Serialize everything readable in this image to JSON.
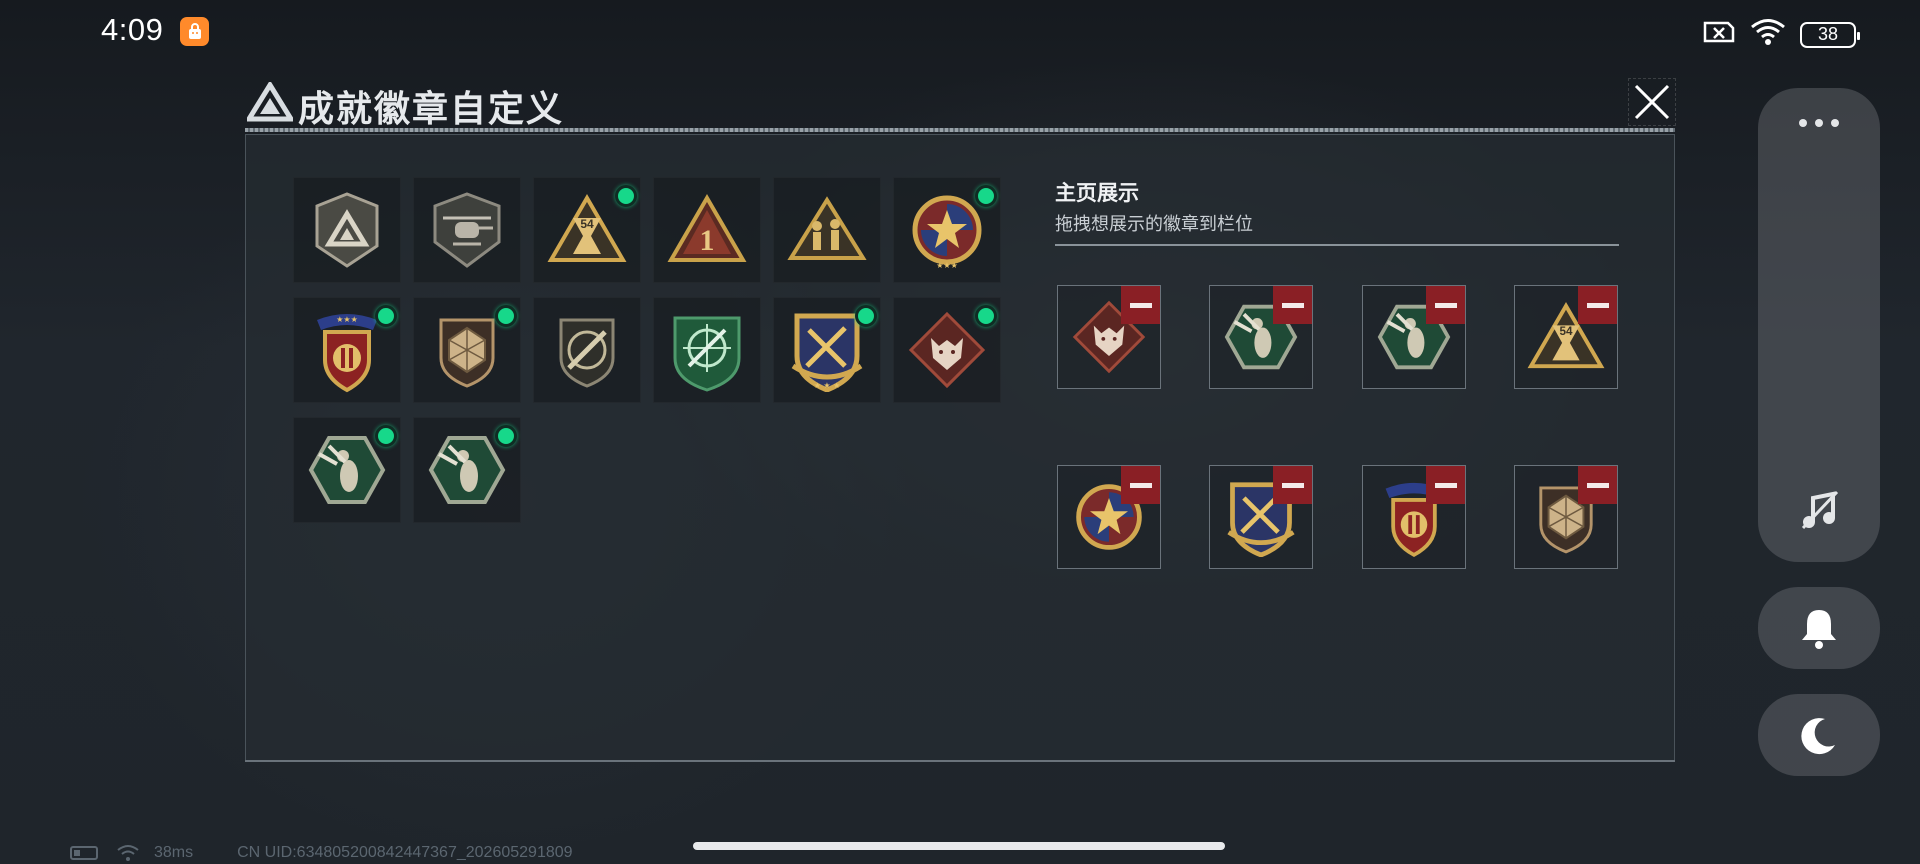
{
  "status_bar": {
    "time": "4:09",
    "battery_level": "38"
  },
  "dialog": {
    "title": "成就徽章自定义"
  },
  "badges": [
    {
      "icon": "tri-logo-badge",
      "new": false
    },
    {
      "icon": "helicopter-badge",
      "new": false
    },
    {
      "icon": "54-hourglass-badge",
      "new": true
    },
    {
      "icon": "number-1-badge",
      "new": false
    },
    {
      "icon": "soldiers-badge",
      "new": false
    },
    {
      "icon": "star-medal-badge",
      "new": true
    },
    {
      "icon": "ribbon-shield-badge",
      "new": true
    },
    {
      "icon": "hex-shield-badge",
      "new": true
    },
    {
      "icon": "rifle-shield-badge",
      "new": false
    },
    {
      "icon": "green-crosshair-badge",
      "new": false
    },
    {
      "icon": "crossed-swords-badge",
      "new": true
    },
    {
      "icon": "wolf-badge",
      "new": true
    },
    {
      "icon": "wasp-badge",
      "new": true
    },
    {
      "icon": "wasp-badge",
      "new": true
    }
  ],
  "showcase": {
    "title": "主页展示",
    "hint": "拖拽想展示的徽章到栏位",
    "slots": [
      {
        "icon": "wolf-badge"
      },
      {
        "icon": "wasp-badge"
      },
      {
        "icon": "wasp-badge"
      },
      {
        "icon": "54-hourglass-badge"
      },
      {
        "icon": "star-medal-badge"
      },
      {
        "icon": "crossed-swords-badge"
      },
      {
        "icon": "ribbon-shield-badge"
      },
      {
        "icon": "hex-shield-badge"
      }
    ]
  },
  "footer": {
    "ping": "38ms",
    "uid": "CN UID:634805200842447367_202605291809"
  },
  "colors": {
    "new_dot": "#17d88a",
    "remove_button": "#8a1f25",
    "gold": "#c9a24a"
  }
}
